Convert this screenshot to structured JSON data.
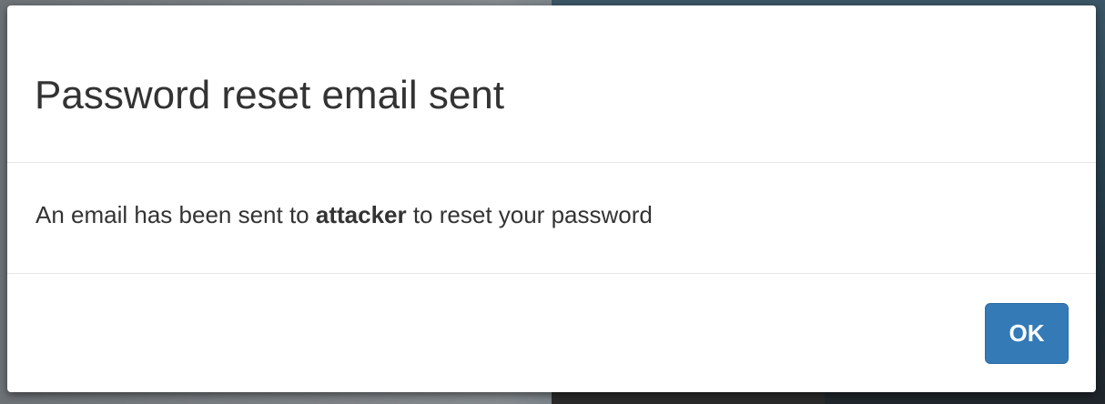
{
  "dialog": {
    "title": "Password reset email sent",
    "message_prefix": "An email has been sent to ",
    "message_recipient": "attacker",
    "message_suffix": " to reset your password",
    "ok_label": "OK"
  },
  "colors": {
    "primary_button": "#337ab7",
    "divider": "#e5e5e5",
    "text": "#333333"
  }
}
